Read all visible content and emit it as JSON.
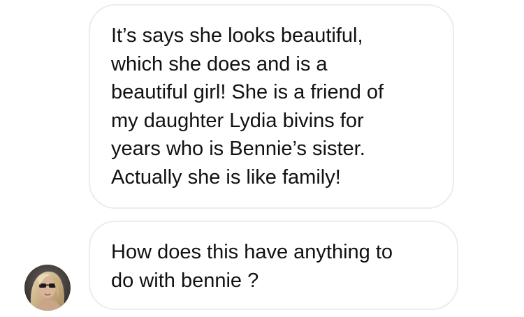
{
  "conversation": {
    "messages": [
      {
        "lines": [
          "It’s says she looks beautiful,",
          "which she does and is a",
          "beautiful girl! She is a friend of",
          "my daughter Lydia bivins for",
          "years who is Bennie’s sister.",
          "Actually she is like family!"
        ]
      },
      {
        "lines": [
          "How does this have anything to",
          "do with bennie ?"
        ]
      }
    ]
  },
  "colors": {
    "bubble_border": "#ececec",
    "text": "#111111",
    "background": "#ffffff"
  },
  "icons": {
    "sender_avatar": "profile-photo"
  }
}
